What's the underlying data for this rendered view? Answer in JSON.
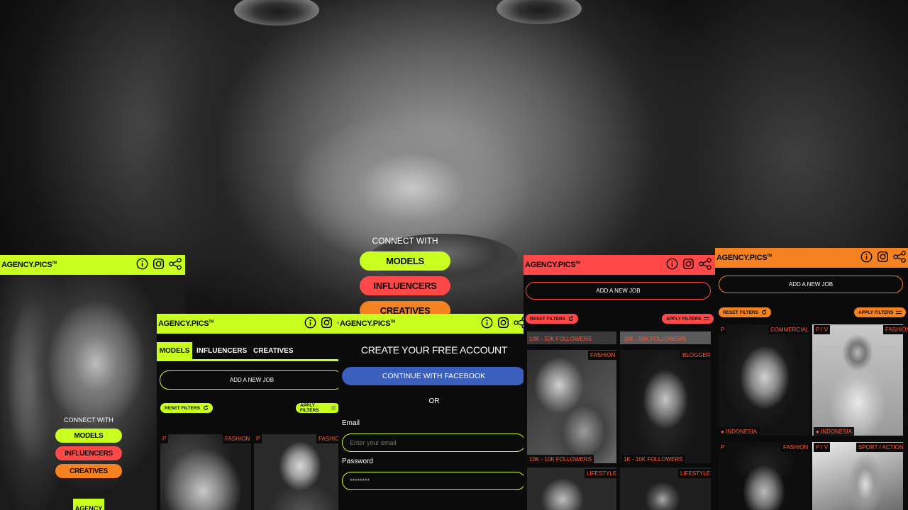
{
  "brand": {
    "logo": "AGENCY.PICS",
    "tm": "TM"
  },
  "colors": {
    "lime": "#c8ff1e",
    "red": "#ff4848",
    "orange": "#f58220",
    "facebook": "#3b5fbd"
  },
  "hero": {
    "connect_with": "CONNECT WITH",
    "models": "MODELS",
    "influencers": "INFLUENCERS",
    "creatives": "CREATIVES"
  },
  "phone_left": {
    "connect_with": "CONNECT WITH",
    "models": "MODELS",
    "influencers": "INFLUENCERS",
    "creatives": "CREATIVES",
    "cta": "AGENCY"
  },
  "jobs_panel": {
    "tabs": [
      "MODELS",
      "INFLUENCERS",
      "CREATIVES"
    ],
    "add_job": "ADD A NEW JOB",
    "reset_filters": "RESET FILTERS",
    "apply_filters": "APPLY FILTERS",
    "cards": [
      {
        "badge": "P",
        "category": "FASHION"
      },
      {
        "badge": "P",
        "category": "FASHION"
      }
    ]
  },
  "signup_panel": {
    "title": "CREATE YOUR FREE ACCOUNT",
    "facebook_button": "CONTINUE WITH FACEBOOK",
    "or": "OR",
    "email_label": "Email",
    "email_placeholder": "Enter your email",
    "password_label": "Password",
    "password_value": "********"
  },
  "influencer_panel": {
    "add_job": "ADD A NEW JOB",
    "reset_filters": "RESET FILTERS",
    "apply_filters": "APPLY FILTERS",
    "cards": [
      {
        "category": "FASHION",
        "followers": "10k - 10k FOLLOWERS"
      },
      {
        "category": "BLOGGER",
        "followers": "1k - 10k FOLLOWERS"
      },
      {
        "category": "LIFESTYLE",
        "followers": ""
      },
      {
        "category": "LIFESTYLE",
        "followers": ""
      }
    ],
    "top_followers": [
      "10k - 50k FOLLOWERS",
      "10k - 50k FOLLOWERS"
    ]
  },
  "creatives_panel": {
    "add_job": "ADD A NEW JOB",
    "reset_filters": "RESET FILTERS",
    "apply_filters": "APPLY FILTERS",
    "cards": [
      {
        "badge": "P",
        "category": "COMMERCIAL",
        "location": "INDONESIA"
      },
      {
        "badge": "P / V",
        "category": "FASHION",
        "location": "INDONESIA"
      },
      {
        "badge": "P",
        "category": "FASHION",
        "location": ""
      },
      {
        "badge": "P / V",
        "category": "SPORT / ACTION",
        "location": ""
      }
    ]
  }
}
